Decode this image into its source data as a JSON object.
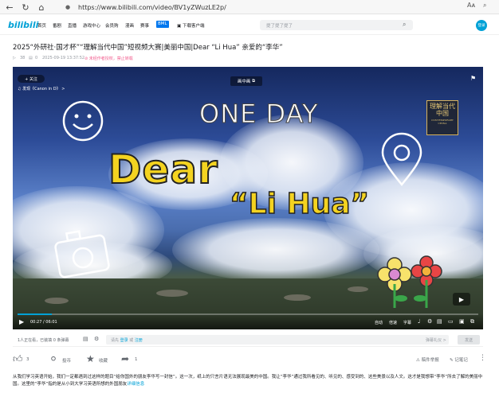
{
  "browser": {
    "url": "https://www.bilibili.com/video/BV1yZWuzLE2p/",
    "reader_label": "Aᴀ"
  },
  "header": {
    "logo": "bilibili",
    "nav": [
      "首页",
      "番剧",
      "直播",
      "游戏中心",
      "会员购",
      "漫画",
      "赛事"
    ],
    "badge": "BML",
    "download": "下载客户端",
    "search_placeholder": "提了提了提了",
    "avatar": "登录"
  },
  "video": {
    "title": "2025“外研社·国才杯”“理解当代中国”短视频大赛|美丽中国|Dear “Li Hua” 亲爱的“李华”",
    "views": "38",
    "danmaku": "0",
    "date": "2025-09-19 13:37:52",
    "no_repost": "未经作者授权，禁止转载"
  },
  "player": {
    "follow": "+ 关注",
    "music": "发现《Canon in D》 >",
    "pip_label": "画中画",
    "oneday": "ONE DAY",
    "dear": "Dear",
    "lihua": "“Li Hua”",
    "seal_text": "理解当代中国",
    "seal_sub": "CONTEMPORARY CHINA",
    "time_current": "00:27",
    "time_total": "06:01",
    "progress": 0.075,
    "controls": [
      "自动",
      "倍速",
      "字幕"
    ]
  },
  "danmaku_bar": {
    "viewers": "1人正在看，已装填 0 条弹幕",
    "input_prefix": "请先",
    "login": "登录",
    "or": "或",
    "register": "注册",
    "etiquette": "弹幕礼仪 >",
    "send": "发送"
  },
  "actions": {
    "like": "3",
    "coin": "投币",
    "fav": "收藏",
    "share": "1",
    "report": "稿件举报",
    "notes": "记笔记"
  },
  "description": {
    "text": "从我们学习英语开始，我们一定都遇到过这样的题目“给你国外的朋友李华写一封信”。这一次，纸上的只言片语无法展现最美的中国。我让“李华”通过我所看见的、听见的、感受到的、这些美景以及人文。这才是我想带“李华”所去了解的美丽中国。这里的“李华”指的是从小到大学习英语所想的外国朋友",
    "link": "详细信息"
  },
  "colors": {
    "accent": "#00a1d6",
    "title_yellow": "#f4d320"
  }
}
